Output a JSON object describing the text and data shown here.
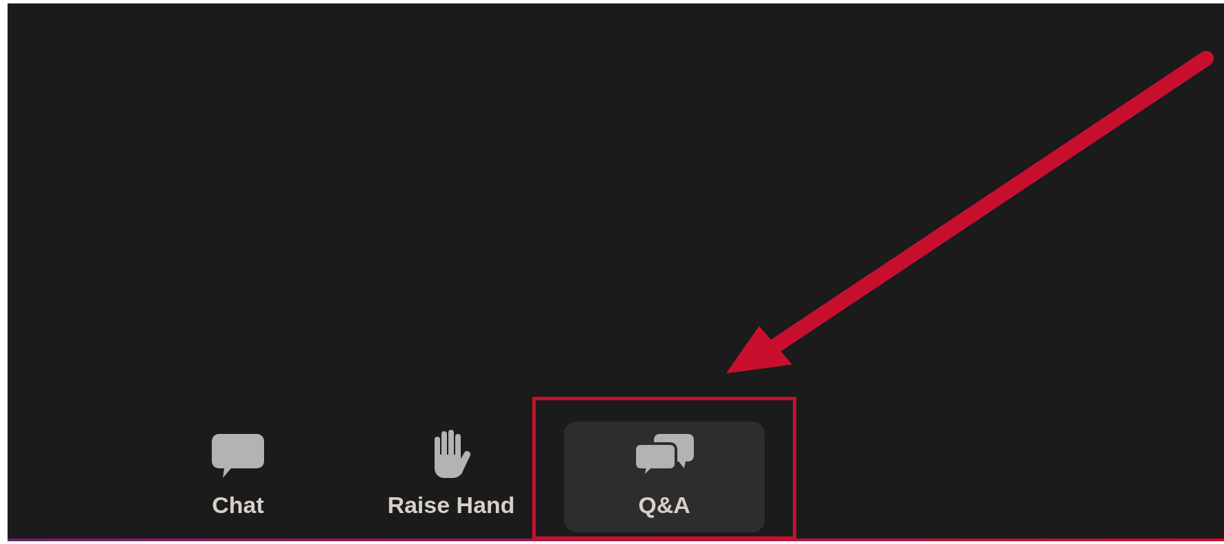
{
  "toolbar": {
    "items": [
      {
        "label": "Chat",
        "selected": false
      },
      {
        "label": "Raise Hand",
        "selected": false
      },
      {
        "label": "Q&A",
        "selected": true
      }
    ]
  }
}
